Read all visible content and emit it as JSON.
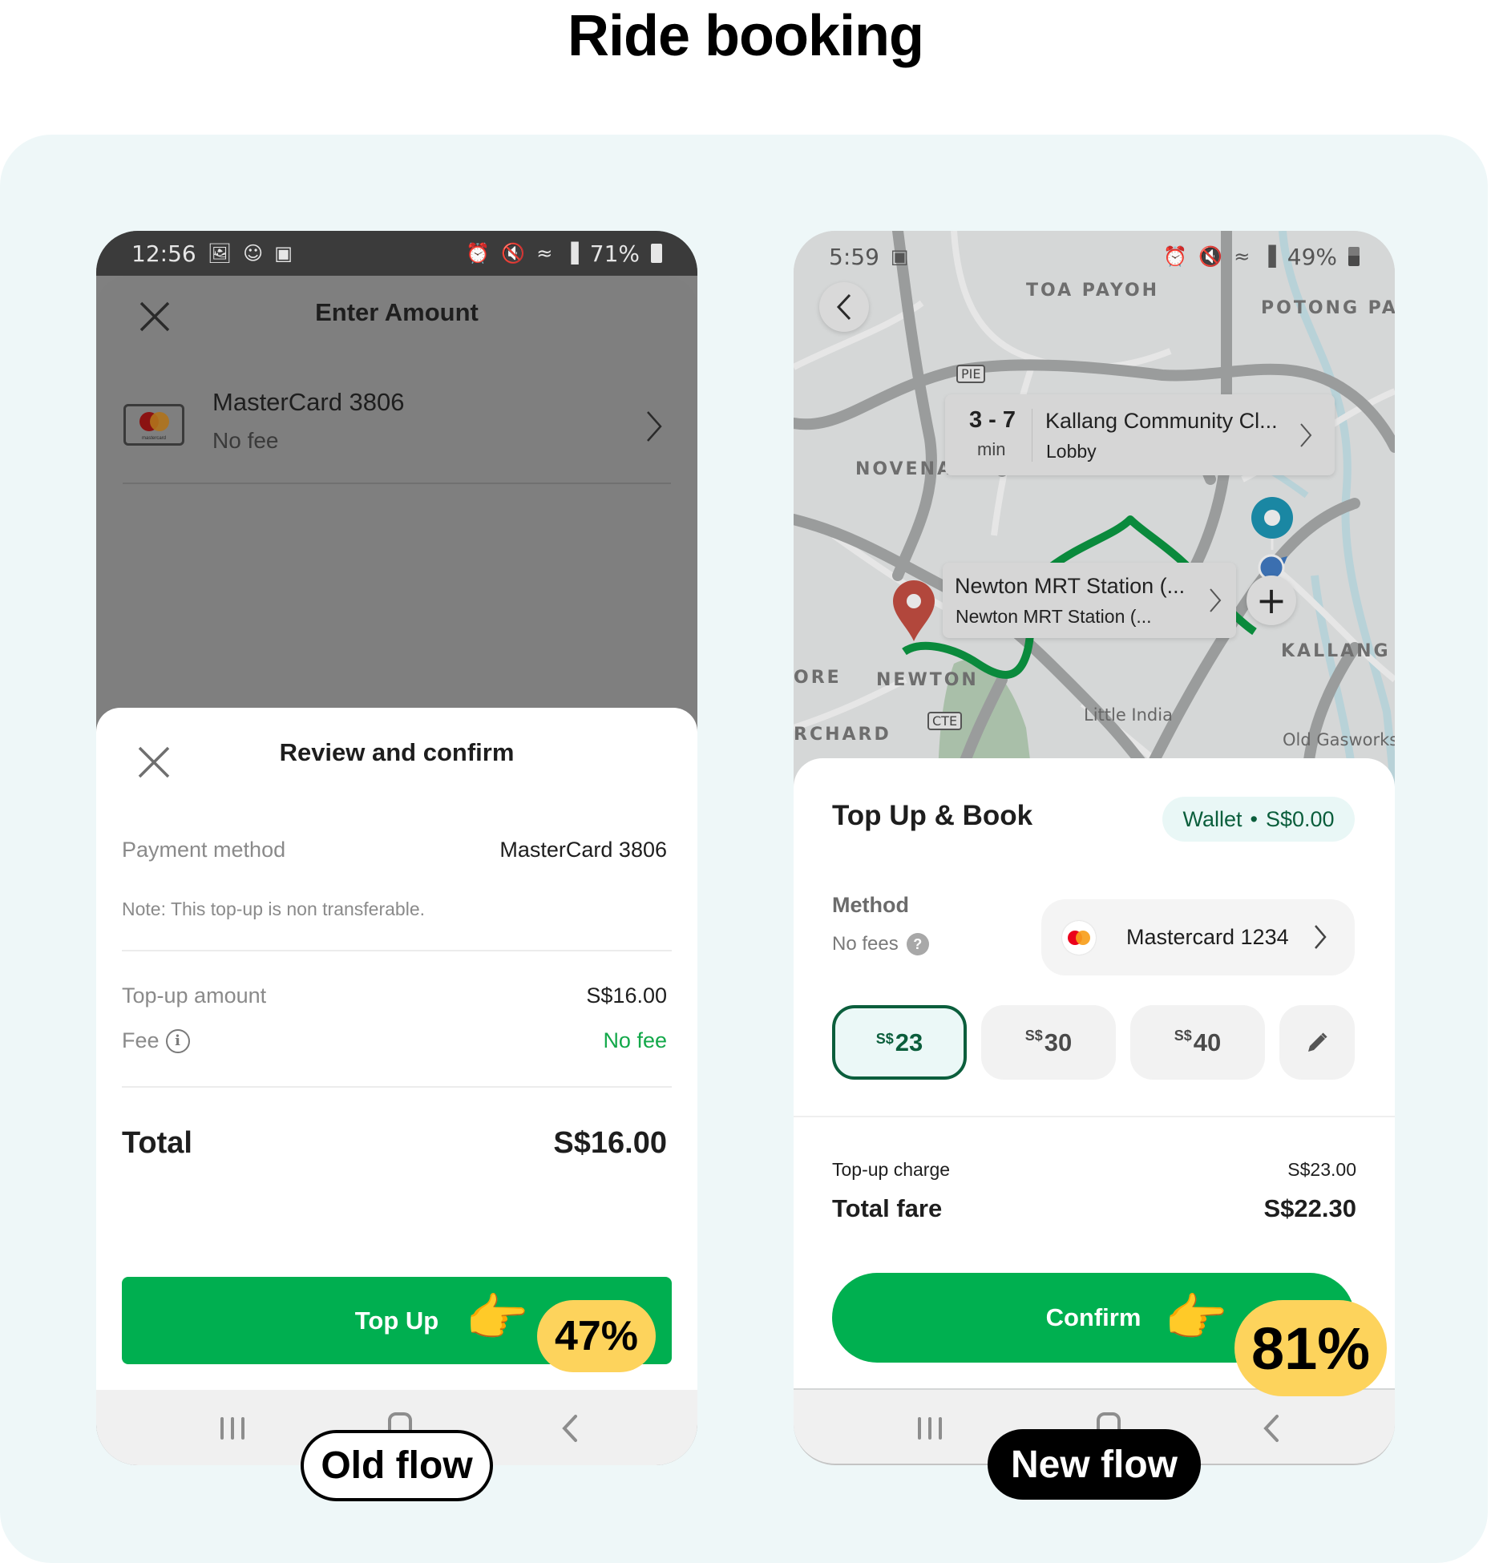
{
  "page": {
    "title": "Ride booking"
  },
  "old_flow": {
    "label": "Old flow",
    "conversion_badge": "47%",
    "status_bar": {
      "time": "12:56",
      "left_icons": [
        "gallery-icon",
        "account-icon",
        "clock-app-icon"
      ],
      "right_icons": [
        "alarm-icon",
        "mute-icon",
        "wifi-icon",
        "signal-icon"
      ],
      "battery": "71%"
    },
    "enter_amount": {
      "title": "Enter Amount",
      "card_name": "MasterCard 3806",
      "card_fee": "No fee",
      "card_brand": "mastercard"
    },
    "review": {
      "title": "Review and confirm",
      "payment_method_label": "Payment method",
      "payment_method_value": "MasterCard 3806",
      "note": "Note: This top-up is non transferable.",
      "topup_amount_label": "Top-up amount",
      "topup_amount_value": "S$16.00",
      "fee_label": "Fee",
      "fee_value": "No fee",
      "total_label": "Total",
      "total_value": "S$16.00",
      "button_label": "Top Up"
    }
  },
  "new_flow": {
    "label": "New flow",
    "conversion_badge": "81%",
    "status_bar": {
      "time": "5:59",
      "left_icons": [
        "clock-app-icon"
      ],
      "right_icons": [
        "alarm-icon",
        "mute-icon",
        "wifi-icon",
        "signal-icon"
      ],
      "battery": "49%"
    },
    "map": {
      "labels": [
        "TOA PAYOH",
        "POTONG PAS",
        "NOVENA",
        "KALLANG",
        "NEWTON",
        "ORE",
        "RCHARD"
      ],
      "poi_labels": [
        "Little India",
        "Old Gasworks"
      ],
      "road_shields": [
        "PIE",
        "CTE",
        "CTE"
      ],
      "pickup": {
        "eta_range": "3 - 7",
        "eta_unit": "min",
        "name": "Kallang Community Cl...",
        "sub": "Lobby"
      },
      "dropoff": {
        "name": "Newton MRT Station (...",
        "sub": "Newton MRT Station (..."
      },
      "zoom_in_label": "+"
    },
    "sheet": {
      "title": "Top Up & Book",
      "wallet_label": "Wallet",
      "wallet_separator": "•",
      "wallet_balance": "S$0.00",
      "method_label": "Method",
      "method_fee": "No fees",
      "help_icon": "?",
      "method_name": "Mastercard 1234",
      "currency_prefix": "S$",
      "amount_options": [
        {
          "value": "23",
          "selected": true
        },
        {
          "value": "30",
          "selected": false
        },
        {
          "value": "40",
          "selected": false
        }
      ],
      "topup_charge_label": "Top-up charge",
      "topup_charge_value": "S$23.00",
      "total_fare_label": "Total fare",
      "total_fare_value": "S$22.30",
      "button_label": "Confirm"
    }
  },
  "colors": {
    "brand_green": "#00b050",
    "selected_green": "#0b5e3c",
    "badge_yellow": "#fdd35c",
    "card_bg": "#eef7f8"
  }
}
